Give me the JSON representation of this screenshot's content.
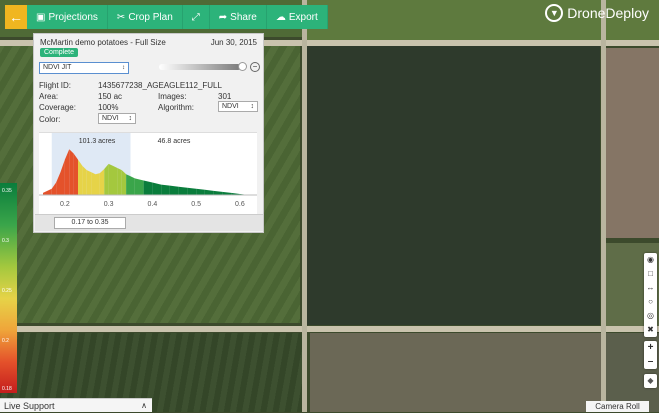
{
  "toolbar": {
    "home_icon": "arrow-left-icon",
    "projections_label": "Projections",
    "crop_plan_label": "Crop Plan",
    "share_label": "Share",
    "export_label": "Export",
    "accent": "#2cb37a",
    "home_color": "#f0b620"
  },
  "logo": {
    "text": "DroneDeploy"
  },
  "panel": {
    "title": "McMartin demo potatoes - Full Size",
    "date": "Jun 30, 2015",
    "status_badge": "Complete",
    "layer_select": "NDVI JIT",
    "flight_id_label": "Flight ID:",
    "flight_id_value": "1435677238_AGEAGLE112_FULL",
    "area_label": "Area:",
    "area_value": "150 ac",
    "images_label": "Images:",
    "images_value": "301",
    "coverage_label": "Coverage:",
    "coverage_value": "100%",
    "algorithm_label": "Algorithm:",
    "algorithm_value": "NDVI",
    "color_label": "Color:",
    "color_value": "NDVI",
    "range_label": "0.17 to 0.35"
  },
  "chart_data": {
    "type": "area",
    "x_ticks": [
      "0.2",
      "0.3",
      "0.4",
      "0.5",
      "0.6"
    ],
    "annotations": [
      "101.3 acres",
      "46.8 acres"
    ],
    "selected_range": [
      0.17,
      0.35
    ],
    "xlim": [
      0.15,
      0.63
    ],
    "x": [
      0.15,
      0.17,
      0.18,
      0.19,
      0.2,
      0.21,
      0.22,
      0.23,
      0.24,
      0.25,
      0.26,
      0.27,
      0.28,
      0.29,
      0.3,
      0.31,
      0.32,
      0.33,
      0.34,
      0.35,
      0.36,
      0.38,
      0.4,
      0.42,
      0.44,
      0.46,
      0.48,
      0.5,
      0.52,
      0.54,
      0.56,
      0.58,
      0.6,
      0.62
    ],
    "y": [
      2,
      6,
      12,
      22,
      34,
      44,
      40,
      34,
      28,
      24,
      22,
      20,
      21,
      25,
      30,
      28,
      26,
      24,
      20,
      18,
      16,
      14,
      12,
      10,
      9,
      8,
      7,
      6,
      5,
      4,
      3,
      2,
      1,
      0
    ]
  },
  "legend": {
    "ticks": [
      "0.35",
      "0.3",
      "0.25",
      "0.2",
      "0.18"
    ]
  },
  "map_tools": {
    "icons": [
      "map-pin-icon",
      "square-icon",
      "ruler-icon",
      "circle-icon",
      "eye-icon",
      "trash-icon"
    ],
    "zoom_in": "+",
    "zoom_out": "–",
    "layers_icon": "layers-icon"
  },
  "footer": {
    "live_support": "Live Support",
    "camera_roll": "Camera Roll"
  }
}
